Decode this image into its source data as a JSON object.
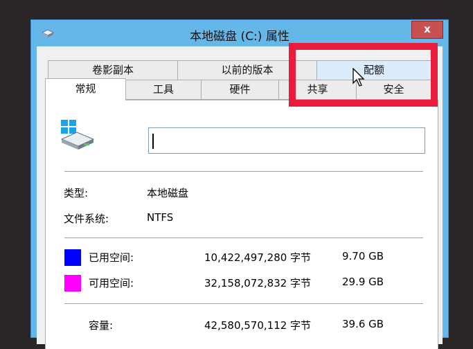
{
  "window": {
    "title": "本地磁盘 (C:) 属性",
    "close_label": "x"
  },
  "tabs_row1": [
    {
      "label": "卷影副本"
    },
    {
      "label": "以前的版本"
    },
    {
      "label": "配额"
    }
  ],
  "tabs_row2": [
    {
      "label": "常规"
    },
    {
      "label": "工具"
    },
    {
      "label": "硬件"
    },
    {
      "label": "共享"
    },
    {
      "label": "安全"
    }
  ],
  "general": {
    "name_value": "",
    "type_label": "类型:",
    "type_value": "本地磁盘",
    "fs_label": "文件系统:",
    "fs_value": "NTFS",
    "used": {
      "label": "已用空间:",
      "bytes": "10,422,497,280 字节",
      "size": "9.70 GB",
      "color": "#0000ff"
    },
    "free": {
      "label": "可用空间:",
      "bytes": "32,158,072,832 字节",
      "size": "29.9 GB",
      "color": "#ff00ff"
    },
    "capacity": {
      "label": "容量:",
      "bytes": "42,580,570,112 字节",
      "size": "39.6 GB"
    }
  },
  "colors": {
    "highlight": "#ea1c3c",
    "titlebar": "#66b7e9",
    "close": "#c75050"
  },
  "icons": {
    "title": "drive-icon",
    "drive": "windows-drive-icon",
    "cursor": "mouse-pointer-icon"
  }
}
